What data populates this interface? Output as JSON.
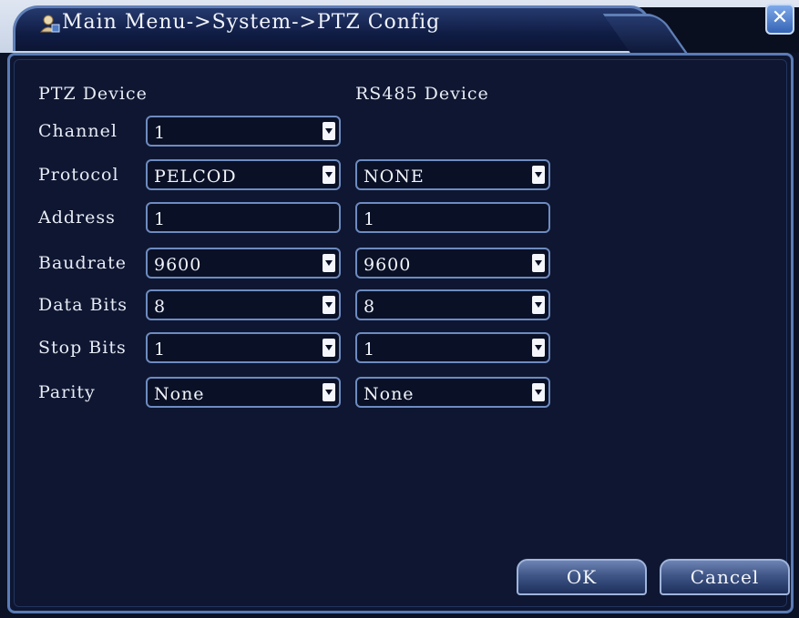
{
  "window": {
    "title": "Main Menu->System->PTZ Config",
    "close_glyph": "✕"
  },
  "sections": {
    "ptz_device": "PTZ Device",
    "rs485_device": "RS485 Device"
  },
  "rows": [
    {
      "label": "Channel",
      "ptz": "1",
      "rs485": null
    },
    {
      "label": "Protocol",
      "ptz": "PELCOD",
      "rs485": "NONE"
    },
    {
      "label": "Address",
      "ptz": "1",
      "rs485": "1"
    },
    {
      "label": "Baudrate",
      "ptz": "9600",
      "rs485": "9600"
    },
    {
      "label": "Data Bits",
      "ptz": "8",
      "rs485": "8"
    },
    {
      "label": "Stop Bits",
      "ptz": "1",
      "rs485": "1"
    },
    {
      "label": "Parity",
      "ptz": "None",
      "rs485": "None"
    }
  ],
  "buttons": {
    "ok": "OK",
    "cancel": "Cancel"
  },
  "icons": {
    "title_icon": "user-icon",
    "close_icon": "close-icon",
    "dropdown_icon": "chevron-down-icon"
  },
  "colors": {
    "panel_bg": "#0e1631",
    "border": "#6e8bc0",
    "text": "#e8ecf6"
  }
}
